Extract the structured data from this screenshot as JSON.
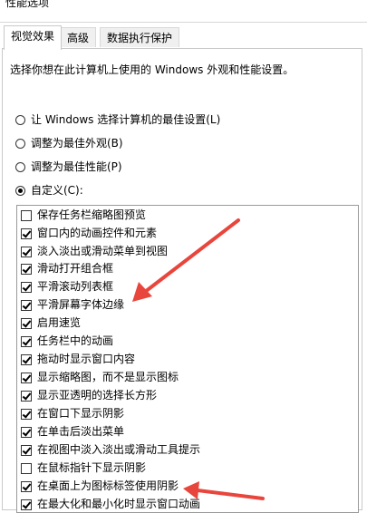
{
  "window": {
    "title": "性能选项"
  },
  "tabs": [
    {
      "label": "视觉效果"
    },
    {
      "label": "高级"
    },
    {
      "label": "数据执行保护"
    }
  ],
  "description": "选择你想在此计算机上使用的 Windows 外观和性能设置。",
  "options": [
    {
      "label": "让 Windows 选择计算机的最佳设置(L)",
      "checked": false
    },
    {
      "label": "调整为最佳外观(B)",
      "checked": false
    },
    {
      "label": "调整为最佳性能(P)",
      "checked": false
    },
    {
      "label": "自定义(C):",
      "checked": true
    }
  ],
  "effects": [
    {
      "label": "保存任务栏缩略图预览",
      "checked": false
    },
    {
      "label": "窗口内的动画控件和元素",
      "checked": true
    },
    {
      "label": "淡入淡出或滑动菜单到视图",
      "checked": true
    },
    {
      "label": "滑动打开组合框",
      "checked": true
    },
    {
      "label": "平滑滚动列表框",
      "checked": true
    },
    {
      "label": "平滑屏幕字体边缘",
      "checked": true
    },
    {
      "label": "启用速览",
      "checked": true
    },
    {
      "label": "任务栏中的动画",
      "checked": true
    },
    {
      "label": "拖动时显示窗口内容",
      "checked": true
    },
    {
      "label": "显示缩略图，而不是显示图标",
      "checked": true
    },
    {
      "label": "显示亚透明的选择长方形",
      "checked": true
    },
    {
      "label": "在窗口下显示阴影",
      "checked": true
    },
    {
      "label": "在单击后淡出菜单",
      "checked": true
    },
    {
      "label": "在视图中淡入淡出或滑动工具提示",
      "checked": true
    },
    {
      "label": "在鼠标指针下显示阴影",
      "checked": false
    },
    {
      "label": "在桌面上为图标标签使用阴影",
      "checked": true
    },
    {
      "label": "在最大化和最小化时显示窗口动画",
      "checked": true
    }
  ],
  "annotation_color": "#e8463c"
}
